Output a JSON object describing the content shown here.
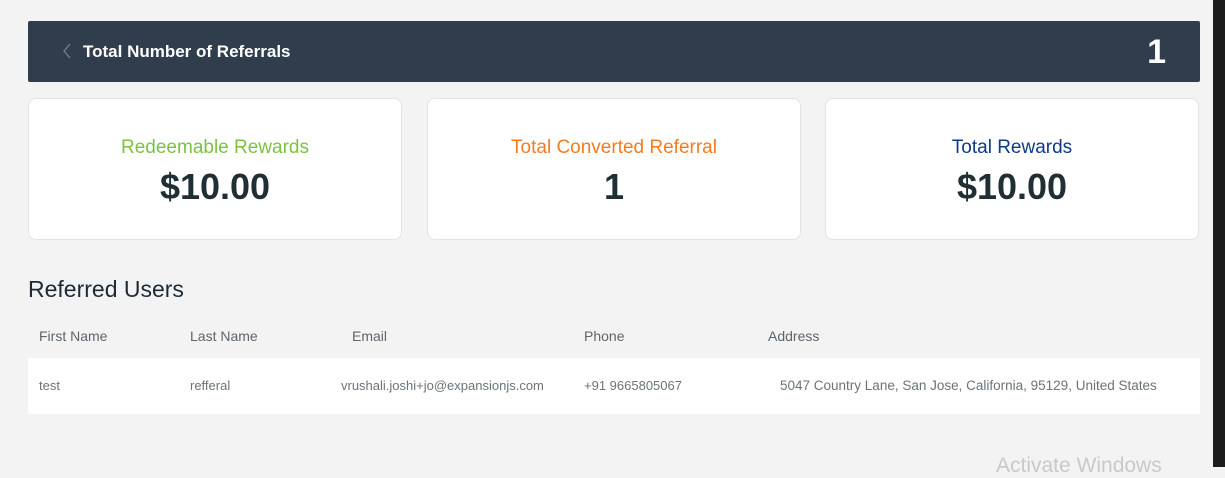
{
  "header": {
    "title": "Total Number of Referrals",
    "count": "1"
  },
  "cards": [
    {
      "label": "Redeemable Rewards",
      "value": "$10.00",
      "label_color": "#7cc242"
    },
    {
      "label": "Total Converted Referral",
      "value": "1",
      "label_color": "#f47b20"
    },
    {
      "label": "Total Rewards",
      "value": "$10.00",
      "label_color": "#0f3a8a"
    }
  ],
  "referred_users": {
    "title": "Referred Users",
    "columns": [
      "First Name",
      "Last Name",
      "Email",
      "Phone",
      "Address"
    ],
    "rows": [
      {
        "first_name": "test",
        "last_name": "refferal",
        "email": "vrushali.joshi+jo@expansionjs.com",
        "phone": "+91 9665805067",
        "address": "5047 Country Lane, San Jose, California, 95129, United States"
      }
    ]
  },
  "watermark": "Activate Windows",
  "icons": {
    "back": "chevron-left-icon"
  }
}
